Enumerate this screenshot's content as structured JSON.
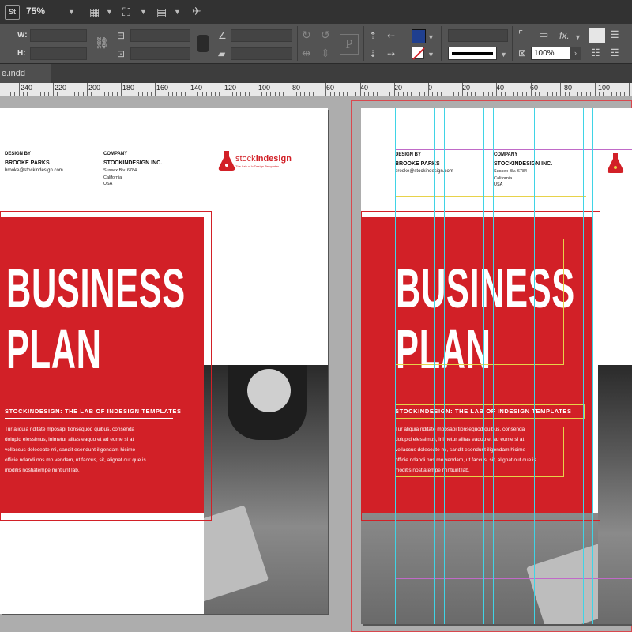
{
  "app": {
    "logo": "St",
    "zoom": "75%"
  },
  "control": {
    "w_label": "W:",
    "h_label": "H:",
    "opacity": "100%",
    "fx_label": "fx."
  },
  "document": {
    "tab_title": "e.indd"
  },
  "ruler": {
    "labels": [
      "240",
      "220",
      "200",
      "180",
      "160",
      "140",
      "120",
      "100",
      "80",
      "60",
      "40",
      "20",
      "0",
      "20",
      "40",
      "60",
      "80",
      "100"
    ]
  },
  "pages": {
    "left": {
      "design_by_label": "DESIGN BY",
      "designer_name": "BROOKE PARKS",
      "designer_email": "brooke@stockindesign.com",
      "company_label": "COMPANY",
      "company_name": "STOCKINDESIGN INC.",
      "company_address1": "Sussex Blv. 6784",
      "company_address2": "California",
      "company_address3": "USA",
      "logo_text_a": "stock",
      "logo_text_b": "indesign",
      "logo_tagline": "The Lab of InDesign Templates",
      "title_line1": "BUSINESS",
      "title_line2": "PLAN",
      "subtitle": "STOCKINDESIGN: THE LAB OF INDESIGN TEMPLATES",
      "body1": "Tur aliquia nditate mposapi tionsequod quibus, consenda",
      "body2": "dolupid elessimus, inimetur alitas eaquo et ad eume si at",
      "body3": "vellaccus doleceate mi, sandit esendunt iligendam hicime",
      "body4": "officie ndandi nos mo vendam, ut faccus, sit, alignat out que is",
      "body5": "moditis nostiatempe mintiunt lab."
    },
    "right": {
      "design_by_label": "DESIGN BY",
      "designer_name": "BROOKE PARKS",
      "designer_email": "brooke@stockindesign.com",
      "company_label": "COMPANY",
      "company_name": "STOCKINDESIGN INC.",
      "company_address1": "Sussex Blv. 6784",
      "company_address2": "California",
      "company_address3": "USA",
      "title_line1": "BUSINESS",
      "title_line2": "PLAN",
      "subtitle": "STOCKINDESIGN: THE LAB OF INDESIGN TEMPLATES",
      "body1": "Tur aliquia nditate mposapi tionsequod quibus, consenda",
      "body2": "dolupid elessimus, inimetur alitas eaquo et ad eume si at",
      "body3": "vellaccus doleceate mi, sandit esendunt iligendam hicime",
      "body4": "officie ndandi nos mo vendam, ut faccus, sit, alignat out que is",
      "body5": "moditis nostiatempe mintiunt lab."
    }
  },
  "colors": {
    "brand_red": "#d22027",
    "fill_swatch": "#1f3f8f",
    "guide_cyan": "#3fd4e6",
    "guide_magenta": "#c06ac8",
    "guide_yellow": "#e7d24a"
  }
}
